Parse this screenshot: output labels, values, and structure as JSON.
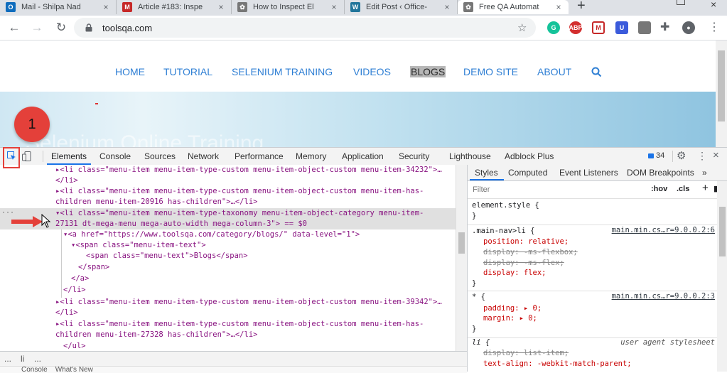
{
  "browser": {
    "tabs": [
      {
        "title": "Mail - Shilpa Nad",
        "favicon": "outlook-icon",
        "color": "#0f6cbd",
        "glyph": "O"
      },
      {
        "title": "Article #183: Inspe",
        "favicon": "article-icon",
        "color": "#c62828",
        "glyph": "M"
      },
      {
        "title": "How to Inspect El",
        "favicon": "gear-favicon",
        "color": "#555555",
        "glyph": "✿"
      },
      {
        "title": "Edit Post ‹ Office-",
        "favicon": "wordpress-icon",
        "color": "#21759b",
        "glyph": "W"
      },
      {
        "title": "Free QA Automat",
        "favicon": "gear-favicon",
        "color": "#555555",
        "glyph": "✿"
      }
    ],
    "new_tab": "+",
    "close_glyph": "×",
    "url": "toolsqa.com"
  },
  "site": {
    "nav": [
      "HOME",
      "TUTORIAL",
      "SELENIUM TRAINING",
      "VIDEOS",
      "BLOGS",
      "DEMO SITE",
      "ABOUT"
    ],
    "hero_text": "Selenium Online Training"
  },
  "devtools": {
    "tabs": [
      "Elements",
      "Console",
      "Sources",
      "Network",
      "Performance",
      "Memory",
      "Application",
      "Security",
      "Lighthouse",
      "Adblock Plus"
    ],
    "issues_count": "34",
    "dom_lines": [
      "▸<li class=\"menu-item menu-item-type-custom menu-item-object-custom menu-item-34232\">…",
      "</li>",
      "▸<li class=\"menu-item menu-item-type-custom menu-item-object-custom menu-item-has-",
      "children menu-item-20916 has-children\">…</li>",
      "▾<li class=\"menu-item menu-item-type-taxonomy menu-item-object-category menu-item-",
      "27131 dt-mega-menu mega-auto-width mega-column-3\"> == $0",
      "▾<a href=\"https://www.toolsqa.com/category/blogs/\" data-level=\"1\">",
      "▾<span class=\"menu-item-text\">",
      "<span class=\"menu-text\">Blogs</span>",
      "</span>",
      "</a>",
      "</li>",
      "▸<li class=\"menu-item menu-item-type-custom menu-item-object-custom menu-item-39342\">…",
      "</li>",
      "▸<li class=\"menu-item menu-item-type-custom menu-item-object-custom menu-item-has-",
      "children menu-item-27328 has-children\">…</li>",
      "</ul>"
    ],
    "breadcrumb": [
      "...",
      "li",
      "..."
    ],
    "styles_tabs": [
      "Styles",
      "Computed",
      "Event Listeners",
      "DOM Breakpoints",
      "»"
    ],
    "filter_placeholder": "Filter",
    "hov": ":hov",
    "cls": ".cls",
    "rules": {
      "element_style": "element.style {",
      "close_brace": "}",
      "r1_selector": ".main-nav>li {",
      "r1_source": "main.min.cs…r=9.0.0.2:6",
      "r1_props": [
        "position: relative;",
        "display: -ms-flexbox;",
        "display: -ms-flex;",
        "display: flex;"
      ],
      "r2_selector": "* {",
      "r2_source": "main.min.cs…r=9.0.0.2:3",
      "r2_props": [
        "padding: ▸ 0;",
        "margin: ▸ 0;"
      ],
      "r3_selector": "li {",
      "r3_source": "user agent stylesheet",
      "r3_props": [
        "display: list-item;",
        "text-align: -webkit-match-parent;"
      ]
    },
    "console_drawer": "Console    What's New"
  },
  "annotation": {
    "step": "1",
    "color": "#e4403a"
  }
}
